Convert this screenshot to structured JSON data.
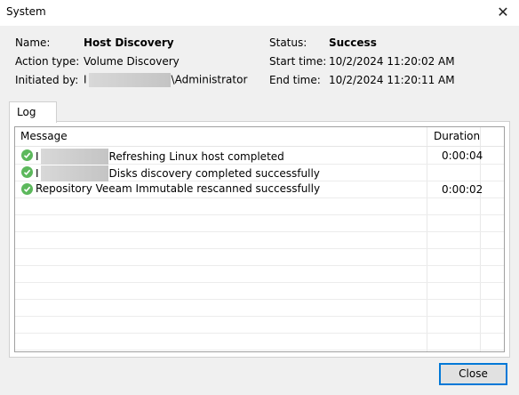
{
  "window": {
    "title": "System",
    "close_glyph": "✕"
  },
  "info": {
    "name_label": "Name:",
    "name_value": "Host Discovery",
    "action_label": "Action type:",
    "action_value": "Volume Discovery",
    "initiated_label": "Initiated by:",
    "initiated_prefix": "I",
    "initiated_suffix": "\\Administrator",
    "status_label": "Status:",
    "status_value": "Success",
    "start_label": "Start time:",
    "start_value": "10/2/2024 11:20:02 AM",
    "end_label": "End time:",
    "end_value": "10/2/2024 11:20:11 AM"
  },
  "tab": {
    "label": "Log"
  },
  "log": {
    "columns": {
      "message": "Message",
      "duration": "Duration"
    },
    "rows": [
      {
        "prefix": "I",
        "redacted": true,
        "text": "Refreshing Linux host completed",
        "duration": "0:00:04",
        "icon": "success-check-icon"
      },
      {
        "prefix": "I",
        "redacted": true,
        "text": "Disks discovery completed successfully",
        "duration": "",
        "icon": "success-check-icon"
      },
      {
        "prefix": "",
        "redacted": false,
        "text": "Repository Veeam Immutable rescanned successfully",
        "duration": "0:00:02",
        "icon": "success-check-icon"
      }
    ]
  },
  "buttons": {
    "close": "Close"
  },
  "colors": {
    "success": "#5cb85c",
    "accent": "#0078d7"
  }
}
